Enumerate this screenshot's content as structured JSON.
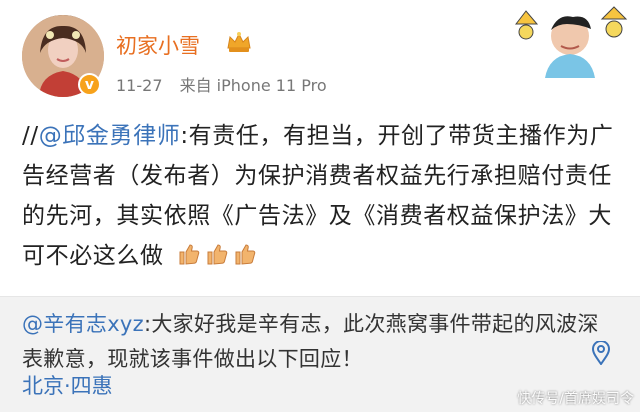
{
  "post": {
    "username": "初家小雪",
    "date": "11-27",
    "source": "来自 iPhone 11 Pro",
    "verified_mark": "v",
    "content": {
      "prefix": "//",
      "mention": "@邱金勇律师",
      "text": ":有责任，有担当，开创了带货主播作为广告经营者（发布者）为保护消费者权益先行承担赔付责任的先河，其实依照《广告法》及《消费者权益保护法》大可不必这么做"
    },
    "reactions": [
      "thumbs-up-icon",
      "thumbs-up-icon",
      "thumbs-up-icon"
    ]
  },
  "repost": {
    "mention": "@辛有志xyz",
    "text": ":大家好我是辛有志，此次燕窝事件带起的风波深表歉意，现就该事件做出以下回应！",
    "location": "北京·四惠"
  },
  "watermark": "快传号/首席娱司令",
  "colors": {
    "username": "#e86f21",
    "link": "#3b73b9",
    "repost_bg": "#f2f2f2",
    "badge": "#f7a21b"
  }
}
